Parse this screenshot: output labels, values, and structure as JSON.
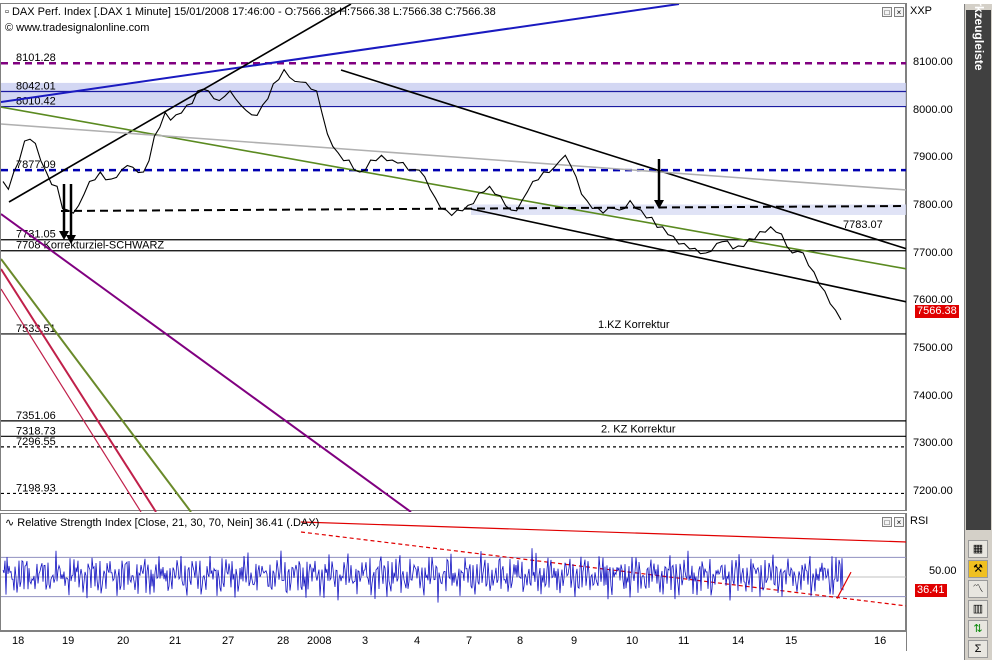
{
  "chart_data": [
    {
      "type": "line",
      "title": "DAX Perf. Index [.DAX  1 Minute] 15/01/2008 17:46:00 - O:7566.38 H:7566.38 L:7566.38 C:7566.38",
      "subtitle": "www.tradesignalonline.com",
      "axis_label": "XXP",
      "ylim": [
        7160,
        8150
      ],
      "yticks": [
        "8100.00",
        "8000.00",
        "7900.00",
        "7800.00",
        "7700.00",
        "7600.00",
        "7500.00",
        "7400.00",
        "7300.00",
        "7200.00"
      ],
      "current_price": "7566.38",
      "levels": [
        {
          "label": "8101.28",
          "value": 8101.28,
          "style": "dashed",
          "color": "#800080"
        },
        {
          "label": "8042.01",
          "value": 8042.01,
          "style": "solid",
          "color": "#1a1aa0"
        },
        {
          "label": "8010.42",
          "value": 8010.42,
          "style": "solid",
          "color": "#1a1aa0"
        },
        {
          "label": "7877.09",
          "value": 7877.09,
          "style": "dashed",
          "color": "#0000b0"
        },
        {
          "label": "7731.05",
          "value": 7731.05,
          "style": "solid",
          "color": "#000000"
        },
        {
          "label": "7708 Korrekturziel-SCHWARZ",
          "value": 7708,
          "style": "solid",
          "color": "#000000"
        },
        {
          "label": "7533.51",
          "value": 7533.51,
          "style": "solid",
          "color": "#000000"
        },
        {
          "label": "7351.06",
          "value": 7351.06,
          "style": "solid",
          "color": "#000000"
        },
        {
          "label": "7318.73",
          "value": 7318.73,
          "style": "solid",
          "color": "#000000"
        },
        {
          "label": "7296.55",
          "value": 7296.55,
          "style": "dashed",
          "color": "#000000"
        },
        {
          "label": "7198.93",
          "value": 7198.93,
          "style": "dashed",
          "color": "#000000"
        }
      ],
      "annotations": [
        {
          "text": "7783.07",
          "at": "right"
        },
        {
          "text": "1.KZ Korrektur",
          "at": "7533.51"
        },
        {
          "text": "2. KZ Korrektur",
          "at": "7318.73"
        }
      ],
      "series": [
        {
          "values": [
            7850,
            7840,
            7870,
            7900,
            7935,
            7945,
            7930,
            7900,
            7870,
            7850,
            7840,
            7800,
            7790,
            7790,
            7800,
            7830,
            7850,
            7860,
            7870,
            7860,
            7855,
            7865,
            7875,
            7890,
            7880,
            7875,
            7870,
            7900,
            7945,
            7970,
            7995,
            7985,
            7990,
            8000,
            8010,
            8020,
            8040,
            8050,
            8040,
            8030,
            8020,
            8035,
            8040,
            8030,
            8010,
            8005,
            7990,
            7995,
            8010,
            8030,
            8055,
            8070,
            8085,
            8075,
            8060,
            8065,
            8058,
            8050,
            8040,
            8000,
            7950,
            7930,
            7910,
            7900,
            7895,
            7880,
            7870,
            7880,
            7895,
            7900,
            7905,
            7900,
            7895,
            7895,
            7890,
            7880,
            7875,
            7880,
            7860,
            7840,
            7815,
            7800,
            7790,
            7785,
            7790,
            7795,
            7800,
            7810,
            7825,
            7835,
            7840,
            7830,
            7820,
            7805,
            7790,
            7795,
            7810,
            7835,
            7850,
            7860,
            7870,
            7875,
            7880,
            7900,
            7905,
            7890,
            7860,
            7830,
            7810,
            7800,
            7795,
            7790,
            7795,
            7800,
            7790,
            7800,
            7810,
            7800,
            7790,
            7780,
            7775,
            7760,
            7755,
            7745,
            7735,
            7725,
            7720,
            7715,
            7710,
            7705,
            7700,
            7710,
            7720,
            7730,
            7725,
            7715,
            7715,
            7720,
            7730,
            7735,
            7745,
            7750,
            7755,
            7750,
            7740,
            7720,
            7700,
            7710,
            7700,
            7680,
            7660,
            7640,
            7620,
            7600,
            7580,
            7566.38
          ]
        }
      ]
    },
    {
      "type": "line",
      "title": "Relative Strength Index [Close, 21, 30, 70, Nein] 36.41 (.DAX)",
      "axis_label": "RSI",
      "ylim": [
        0,
        100
      ],
      "yticks": [
        "50.00"
      ],
      "current_value": "36.41",
      "series": [
        {
          "values": [
            52,
            48,
            60,
            40,
            55,
            45,
            58,
            62,
            42,
            50,
            55,
            47,
            53,
            61,
            44,
            50,
            57,
            49,
            46,
            59,
            52,
            43,
            55,
            51,
            60,
            48,
            56,
            42,
            50,
            63,
            45,
            52,
            48,
            57,
            54,
            40,
            58,
            50,
            46,
            61,
            49,
            53,
            55,
            44,
            52,
            60,
            47,
            51,
            56,
            43,
            58,
            50,
            45,
            62,
            49,
            54,
            52,
            46,
            57,
            50,
            44,
            55,
            59,
            48,
            51,
            53,
            47,
            60,
            45,
            52,
            56,
            49,
            43,
            58,
            54,
            50,
            47,
            55,
            61,
            46,
            52,
            50,
            57,
            48,
            44,
            59,
            53,
            51,
            46,
            55,
            50,
            58,
            47,
            52,
            49,
            45,
            54,
            60,
            43,
            51,
            36.41
          ]
        }
      ]
    }
  ],
  "xticks": [
    "18",
    "19",
    "20",
    "21",
    "27",
    "28",
    "2008",
    "3",
    "4",
    "7",
    "8",
    "9",
    "10",
    "11",
    "14",
    "15",
    "16"
  ],
  "window_buttons": {
    "maximize": "□",
    "close": "×"
  },
  "sidebar": {
    "title": "Werkzeugleiste"
  }
}
